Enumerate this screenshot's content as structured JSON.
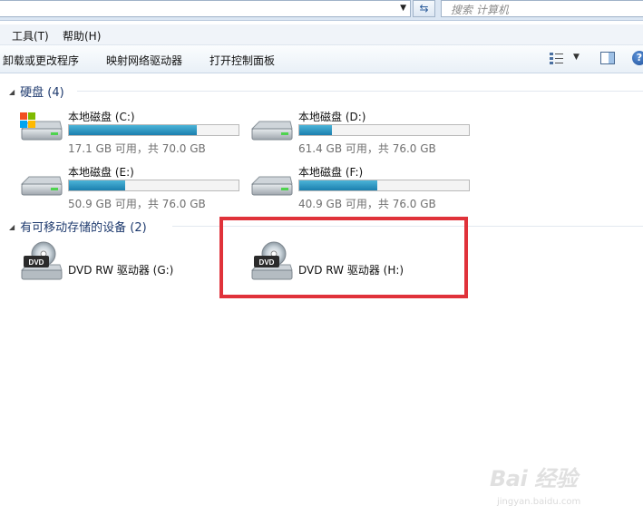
{
  "address_bar": {
    "search_placeholder": "搜索 计算机"
  },
  "menu": {
    "items": [
      "工具(T)",
      "帮助(H)"
    ]
  },
  "commands": {
    "items": [
      "卸载或更改程序",
      "映射网络驱动器",
      "打开控制面板"
    ]
  },
  "groups": {
    "hard_disks": {
      "title": "硬盘 (4)"
    },
    "removable": {
      "title": "有可移动存储的设备 (2)"
    }
  },
  "drives": [
    {
      "name": "本地磁盘 (C:)",
      "free_text": "17.1 GB 可用，共 70.0 GB",
      "used_fraction": 0.756,
      "is_system": true
    },
    {
      "name": "本地磁盘 (D:)",
      "free_text": "61.4 GB 可用，共 76.0 GB",
      "used_fraction": 0.192,
      "is_system": false
    },
    {
      "name": "本地磁盘 (E:)",
      "free_text": "50.9 GB 可用，共 76.0 GB",
      "used_fraction": 0.33,
      "is_system": false
    },
    {
      "name": "本地磁盘 (F:)",
      "free_text": "40.9 GB 可用，共 76.0 GB",
      "used_fraction": 0.462,
      "is_system": false
    }
  ],
  "dvd_drives": [
    {
      "name": "DVD RW 驱动器 (G:)",
      "icon_label": "DVD"
    },
    {
      "name": "DVD RW 驱动器 (H:)",
      "icon_label": "DVD"
    }
  ],
  "watermark": {
    "logo_text": "Bai 经验",
    "url_text": "jingyan.baidu.com"
  },
  "colors": {
    "usage_fill": "#1b7fae",
    "highlight": "#e0323a",
    "group_header": "#1e3a6e"
  }
}
